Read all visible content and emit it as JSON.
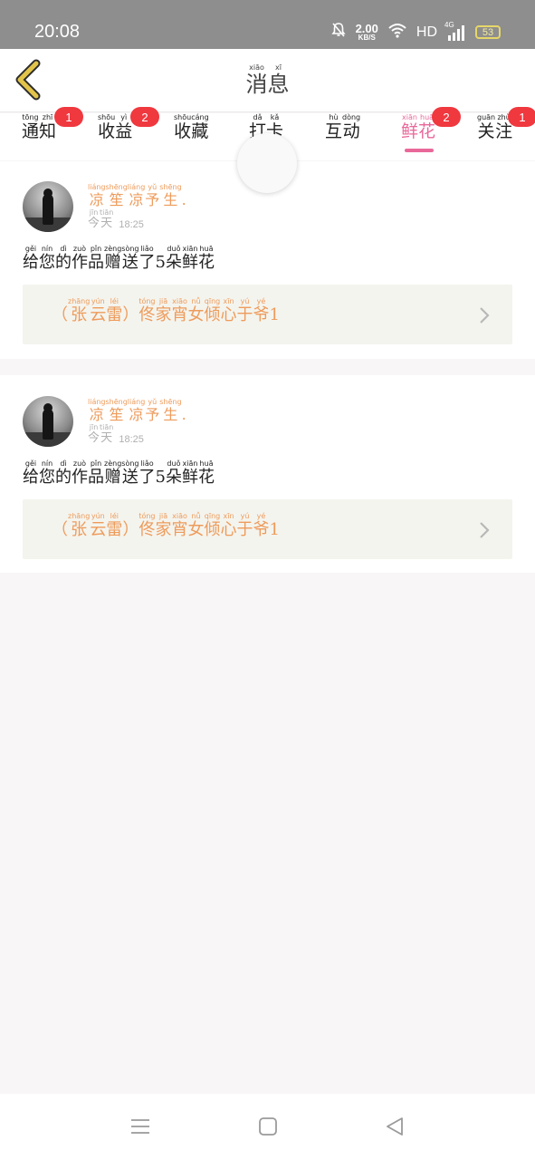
{
  "status_bar": {
    "time": "20:08",
    "speed": "2.00",
    "speed_unit": "KB/S",
    "hd": "HD",
    "network": "4G",
    "battery": "53",
    "icons": [
      "bell-muted-icon",
      "wifi-icon",
      "signal-icon",
      "battery-icon"
    ]
  },
  "header": {
    "title": [
      {
        "c": "消",
        "p": "xiāo"
      },
      {
        "c": "息",
        "p": "xī"
      }
    ],
    "back_icon": "chevron-left-icon"
  },
  "tabs": [
    {
      "id": "notice",
      "label": [
        {
          "c": "通",
          "p": "tōng"
        },
        {
          "c": "知",
          "p": "zhī"
        }
      ],
      "badge": "1",
      "active": false
    },
    {
      "id": "income",
      "label": [
        {
          "c": "收",
          "p": "shōu"
        },
        {
          "c": "益",
          "p": "yì"
        }
      ],
      "badge": "2",
      "active": false
    },
    {
      "id": "favorite",
      "label": [
        {
          "c": "收",
          "p": "shōu"
        },
        {
          "c": "藏",
          "p": "cáng"
        }
      ],
      "badge": "",
      "active": false
    },
    {
      "id": "hit",
      "label": [
        {
          "c": "打",
          "p": "dǎ"
        },
        {
          "c": "卡",
          "p": "kǎ"
        }
      ],
      "badge": "",
      "active": false
    },
    {
      "id": "interact",
      "label": [
        {
          "c": "互",
          "p": "hù"
        },
        {
          "c": "动",
          "p": "dòng"
        }
      ],
      "badge": "",
      "active": false
    },
    {
      "id": "flower",
      "label": [
        {
          "c": "鲜",
          "p": "xiān"
        },
        {
          "c": "花",
          "p": "huā"
        }
      ],
      "badge": "2",
      "active": true
    },
    {
      "id": "follow",
      "label": [
        {
          "c": "关",
          "p": "guān"
        },
        {
          "c": "注",
          "p": "zhù"
        }
      ],
      "badge": "1",
      "active": false
    }
  ],
  "messages": [
    {
      "username": [
        {
          "c": "凉",
          "p": "liáng"
        },
        {
          "c": "笙",
          "p": "shēng"
        },
        {
          "c": "凉",
          "p": "liáng"
        },
        {
          "c": "予",
          "p": "yǔ"
        },
        {
          "c": "生",
          "p": "shēng"
        },
        {
          "c": ".",
          "p": ""
        }
      ],
      "date": [
        {
          "c": "今",
          "p": "jīn"
        },
        {
          "c": "天",
          "p": "tiān"
        }
      ],
      "time": "18:25",
      "text": [
        {
          "c": "给",
          "p": "gěi"
        },
        {
          "c": "您",
          "p": "nín"
        },
        {
          "c": "的",
          "p": "dì"
        },
        {
          "c": "作",
          "p": "zuò"
        },
        {
          "c": "品",
          "p": "pǐn"
        },
        {
          "c": "赠",
          "p": "zèng"
        },
        {
          "c": "送",
          "p": "sòng"
        },
        {
          "c": "了",
          "p": "liǎo"
        },
        {
          "c": "5",
          "p": ""
        },
        {
          "c": "朵",
          "p": "duǒ"
        },
        {
          "c": "鲜",
          "p": "xiān"
        },
        {
          "c": "花",
          "p": "huā"
        }
      ],
      "work": [
        {
          "c": "（",
          "p": ""
        },
        {
          "c": "张",
          "p": "zhāng"
        },
        {
          "c": "云",
          "p": "yún"
        },
        {
          "c": "雷",
          "p": "léi"
        },
        {
          "c": "）",
          "p": ""
        },
        {
          "c": "佟",
          "p": "tóng"
        },
        {
          "c": "家",
          "p": "jiā"
        },
        {
          "c": "宵",
          "p": "xiāo"
        },
        {
          "c": "女",
          "p": "nǚ"
        },
        {
          "c": "倾",
          "p": "qīng"
        },
        {
          "c": "心",
          "p": "xīn"
        },
        {
          "c": "于",
          "p": "yú"
        },
        {
          "c": "爷",
          "p": "yé"
        },
        {
          "c": "1",
          "p": ""
        }
      ]
    },
    {
      "username": [
        {
          "c": "凉",
          "p": "liáng"
        },
        {
          "c": "笙",
          "p": "shēng"
        },
        {
          "c": "凉",
          "p": "liáng"
        },
        {
          "c": "予",
          "p": "yǔ"
        },
        {
          "c": "生",
          "p": "shēng"
        },
        {
          "c": ".",
          "p": ""
        }
      ],
      "date": [
        {
          "c": "今",
          "p": "jīn"
        },
        {
          "c": "天",
          "p": "tiān"
        }
      ],
      "time": "18:25",
      "text": [
        {
          "c": "给",
          "p": "gěi"
        },
        {
          "c": "您",
          "p": "nín"
        },
        {
          "c": "的",
          "p": "dì"
        },
        {
          "c": "作",
          "p": "zuò"
        },
        {
          "c": "品",
          "p": "pǐn"
        },
        {
          "c": "赠",
          "p": "zèng"
        },
        {
          "c": "送",
          "p": "sòng"
        },
        {
          "c": "了",
          "p": "liǎo"
        },
        {
          "c": "5",
          "p": ""
        },
        {
          "c": "朵",
          "p": "duǒ"
        },
        {
          "c": "鲜",
          "p": "xiān"
        },
        {
          "c": "花",
          "p": "huā"
        }
      ],
      "work": [
        {
          "c": "（",
          "p": ""
        },
        {
          "c": "张",
          "p": "zhāng"
        },
        {
          "c": "云",
          "p": "yún"
        },
        {
          "c": "雷",
          "p": "léi"
        },
        {
          "c": "）",
          "p": ""
        },
        {
          "c": "佟",
          "p": "tóng"
        },
        {
          "c": "家",
          "p": "jiā"
        },
        {
          "c": "宵",
          "p": "xiāo"
        },
        {
          "c": "女",
          "p": "nǚ"
        },
        {
          "c": "倾",
          "p": "qīng"
        },
        {
          "c": "心",
          "p": "xīn"
        },
        {
          "c": "于",
          "p": "yú"
        },
        {
          "c": "爷",
          "p": "yé"
        },
        {
          "c": "1",
          "p": ""
        }
      ]
    }
  ],
  "navbar": {
    "icons": [
      "menu-icon",
      "home-square-icon",
      "back-triangle-icon"
    ]
  },
  "colors": {
    "accent": "#e9689a",
    "orange_text": "#ee9b5b",
    "badge": "#f0383f",
    "back_arrow": "#e2c44a"
  }
}
